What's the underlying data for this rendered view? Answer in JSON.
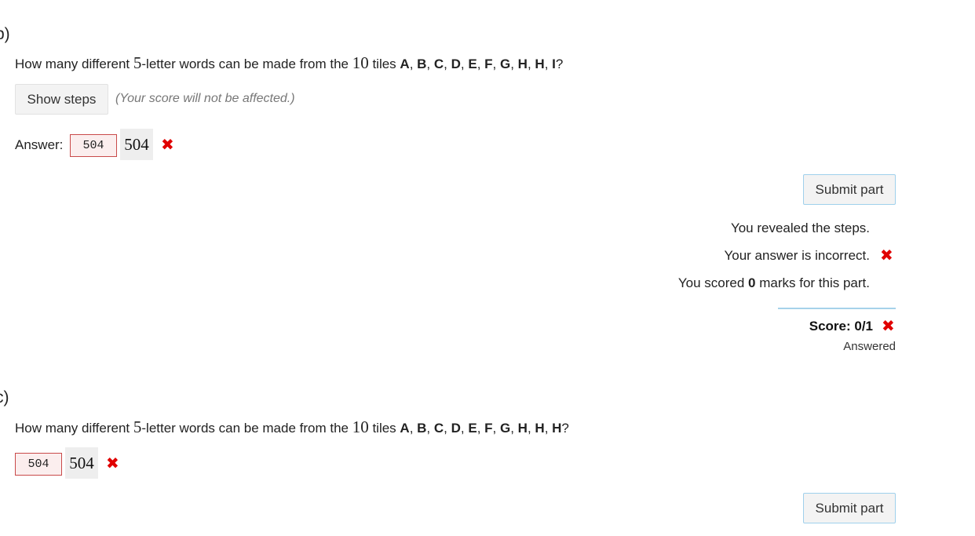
{
  "parts": [
    {
      "label": "b)",
      "prompt": {
        "pre": "How many different ",
        "n": "5",
        "mid": "-letter words can be made from the ",
        "count": "10",
        "post": " tiles ",
        "tiles": [
          "A",
          "B",
          "C",
          "D",
          "E",
          "F",
          "G",
          "H",
          "H",
          "I"
        ],
        "end": "?"
      },
      "show_steps_label": "Show steps",
      "steps_hint": "(Your score will not be affected.)",
      "answer_label": "Answer:",
      "answer_value": "504",
      "answer_preview": "504",
      "answer_status_icon": "cross-icon",
      "submit_label": "Submit part",
      "feedback": {
        "revealed": "You revealed the steps.",
        "incorrect": "Your answer is incorrect.",
        "scored_pre": "You scored ",
        "scored_value": "0",
        "scored_post": " marks for this part."
      },
      "score": "Score: 0/1",
      "status": "Answered"
    },
    {
      "label": "c)",
      "prompt": {
        "pre": "How many different ",
        "n": "5",
        "mid": "-letter words can be made from the ",
        "count": "10",
        "post": " tiles ",
        "tiles": [
          "A",
          "B",
          "C",
          "D",
          "E",
          "F",
          "G",
          "H",
          "H",
          "H"
        ],
        "end": "?"
      },
      "answer_value": "504",
      "answer_preview": "504",
      "answer_status_icon": "cross-icon",
      "submit_label": "Submit part"
    }
  ],
  "colors": {
    "incorrect": "#e00000",
    "input_border_invalid": "#c94a4a",
    "input_bg_invalid": "#fbeeee",
    "divider": "#a6d2ea"
  }
}
